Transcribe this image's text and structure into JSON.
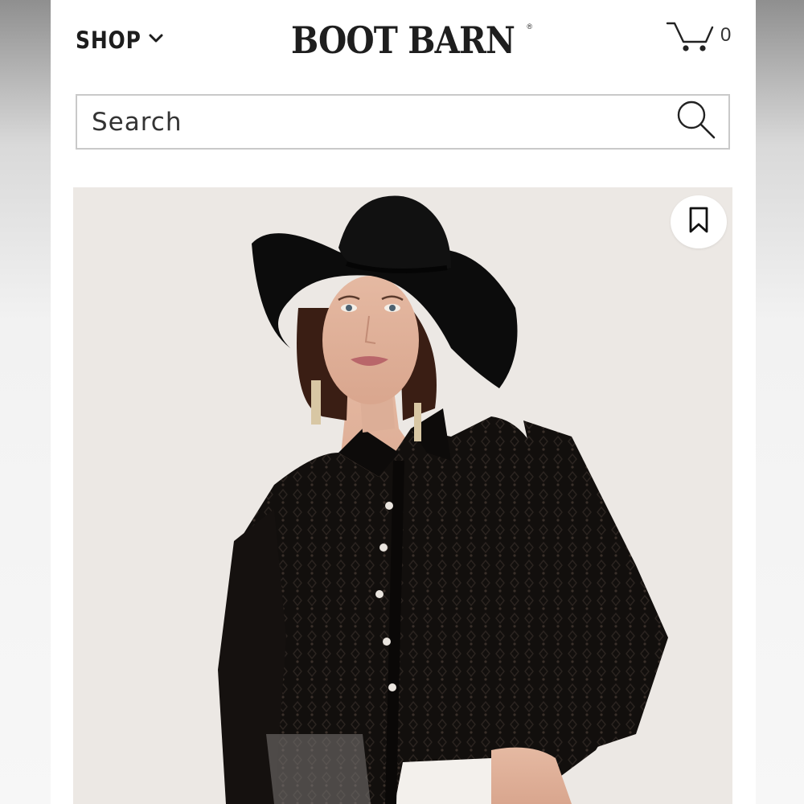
{
  "header": {
    "shop_label": "SHOP",
    "logo_text": "BOOT BARN",
    "logo_mark": "®",
    "cart_count": "0"
  },
  "search": {
    "placeholder": "Search"
  },
  "product": {
    "image_subject": "model in black cowboy hat and sheer black lace button-up shirt",
    "background_color": "#ece8e4"
  },
  "icons": {
    "shop_chevron": "chevron-down-icon",
    "cart": "cart-icon",
    "search": "search-icon",
    "wishlist": "bookmark-icon"
  }
}
